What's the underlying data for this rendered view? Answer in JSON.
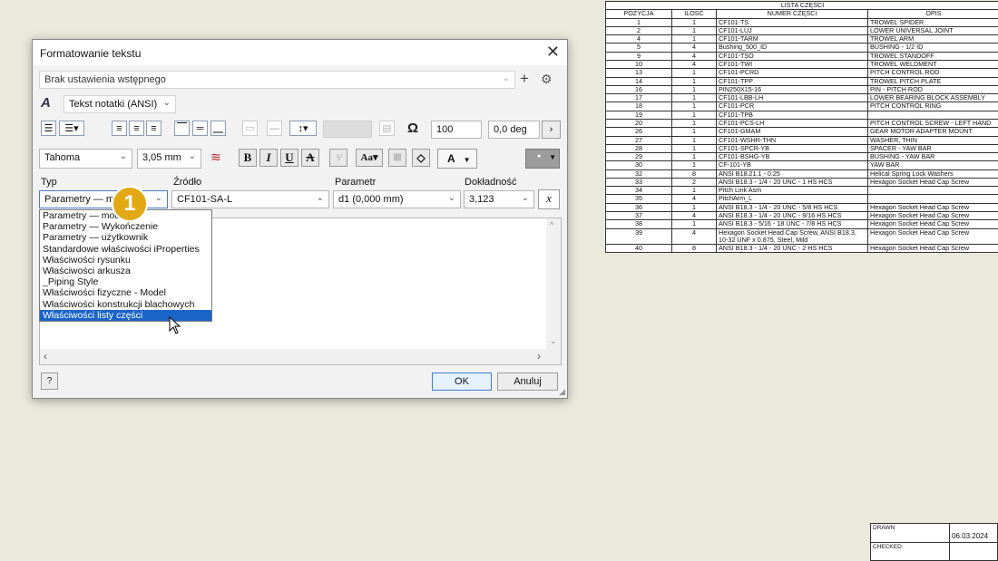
{
  "parts_list": {
    "title": "LISTA CZĘŚCI",
    "headers": [
      "POZYCJA",
      "ILOŚĆ",
      "NUMER CZĘŚCI",
      "OPIS"
    ],
    "rows": [
      [
        "1",
        "1",
        "CF101-TS",
        "TROWEL SPIDER"
      ],
      [
        "2",
        "1",
        "CF101-LUJ",
        "LOWER UNIVERSAL JOINT"
      ],
      [
        "4",
        "1",
        "CF101-TARM",
        "TROWEL ARM"
      ],
      [
        "5",
        "4",
        "Bushing_500_ID",
        "BUSHING - 1/2 ID"
      ],
      [
        "9",
        "4",
        "CF101-TSO",
        "TROWEL STANDOFF"
      ],
      [
        "10",
        "4",
        "CF101-TWI",
        "TROWEL WELDMENT"
      ],
      [
        "13",
        "1",
        "CF101-PCRD",
        "PITCH CONTROL ROD"
      ],
      [
        "14",
        "1",
        "CF101-TPP",
        "TROWEL PITCH PLATE"
      ],
      [
        "16",
        "1",
        "PIN250X15-16",
        "PIN - PITCH ROD"
      ],
      [
        "17",
        "1",
        "CF101-LBB-LH",
        "LOWER BEARING BLOCK ASSEMBLY"
      ],
      [
        "18",
        "1",
        "CF101-PCR",
        "PITCH CONTROL RING"
      ],
      [
        "19",
        "1",
        "CF101-TPB",
        ""
      ],
      [
        "20",
        "1",
        "CF101-PCS-LH",
        "PITCH CONTROL SCREW - LEFT HAND"
      ],
      [
        "26",
        "1",
        "CF101-GMAM",
        "GEAR MOTOR ADAPTER MOUNT"
      ],
      [
        "27",
        "1",
        "CF101-WSHR-THN",
        "WASHER, THIN"
      ],
      [
        "28",
        "1",
        "CF101-SPCR-YB",
        "SPACER - YAW BAR"
      ],
      [
        "29",
        "1",
        "CF101-BSHG-YB",
        "BUSHING - YAW BAR"
      ],
      [
        "30",
        "1",
        "CF-101-YB",
        "YAW BAR"
      ],
      [
        "32",
        "8",
        "ANSI B18.21.1 - 0.25",
        "Helical Spring Lock Washers"
      ],
      [
        "33",
        "2",
        "ANSI B18.3 - 1/4 - 20 UNC - 1 HS HCS",
        "Hexagon Socket Head Cap Screw"
      ],
      [
        "34",
        "1",
        "Pitch Link Asm",
        ""
      ],
      [
        "35",
        "4",
        "PitchArm_L",
        ""
      ],
      [
        "36",
        "1",
        "ANSI B18.3 - 1/4 - 20 UNC - 5/8 HS HCS",
        "Hexagon Socket Head Cap Screw"
      ],
      [
        "37",
        "4",
        "ANSI B18.3 - 1/4 - 20 UNC - 9/16 HS HCS",
        "Hexagon Socket Head Cap Screw"
      ],
      [
        "38",
        "1",
        "ANSI B18.3 - 5/16 - 18 UNC - 7/8 HS HCS",
        "Hexagon Socket Head Cap Screw"
      ],
      [
        "39",
        "4",
        "Hexagon Socket Head Cap Screw, ANSI B18.3, 10-32 UNF x 0.875, Steel, Mild",
        "Hexagon Socket Head Cap Screw"
      ],
      [
        "40",
        "8",
        "ANSI B18.3 - 1/4 - 20 UNC - 2 HS HCS",
        "Hexagon Socket Head Cap Screw"
      ]
    ]
  },
  "title_block": {
    "drawn_label": "DRAWN",
    "checked_label": "CHECKED",
    "date": "06.03.2024"
  },
  "dialog": {
    "title": "Formatowanie tekstu",
    "preset": "Brak ustawienia wstępnego",
    "style": "Tekst notatki (ANSI)",
    "spacing_value": "100",
    "rotation_value": "0,0 deg",
    "font": "Tahoma",
    "font_size": "3,05 mm",
    "color_letter": "A",
    "type_label": "Typ",
    "source_label": "Źródło",
    "param_label": "Parametr",
    "precision_label": "Dokładność",
    "type_value": "Parametry — model",
    "source_value": "CF101-SA-L",
    "param_value": "d1 (0,000 mm)",
    "precision_value": "3,123",
    "type_options": [
      "Parametry — model",
      "Parametry — Wykończenie",
      "Parametry — użytkownik",
      "Standardowe właściwości iProperties",
      "Właściwości rysunku",
      "Właściwości arkusza",
      "_Piping Style",
      "Właściwości fizyczne - Model",
      "Właściwości konstrukcji blachowych",
      "Właściwości listy części"
    ],
    "ok_label": "OK",
    "cancel_label": "Anuluj"
  },
  "callout_number": "1",
  "colors": {
    "highlight": "#1a64c8",
    "callout": "#e2a915",
    "background": "#ebe9dc"
  }
}
